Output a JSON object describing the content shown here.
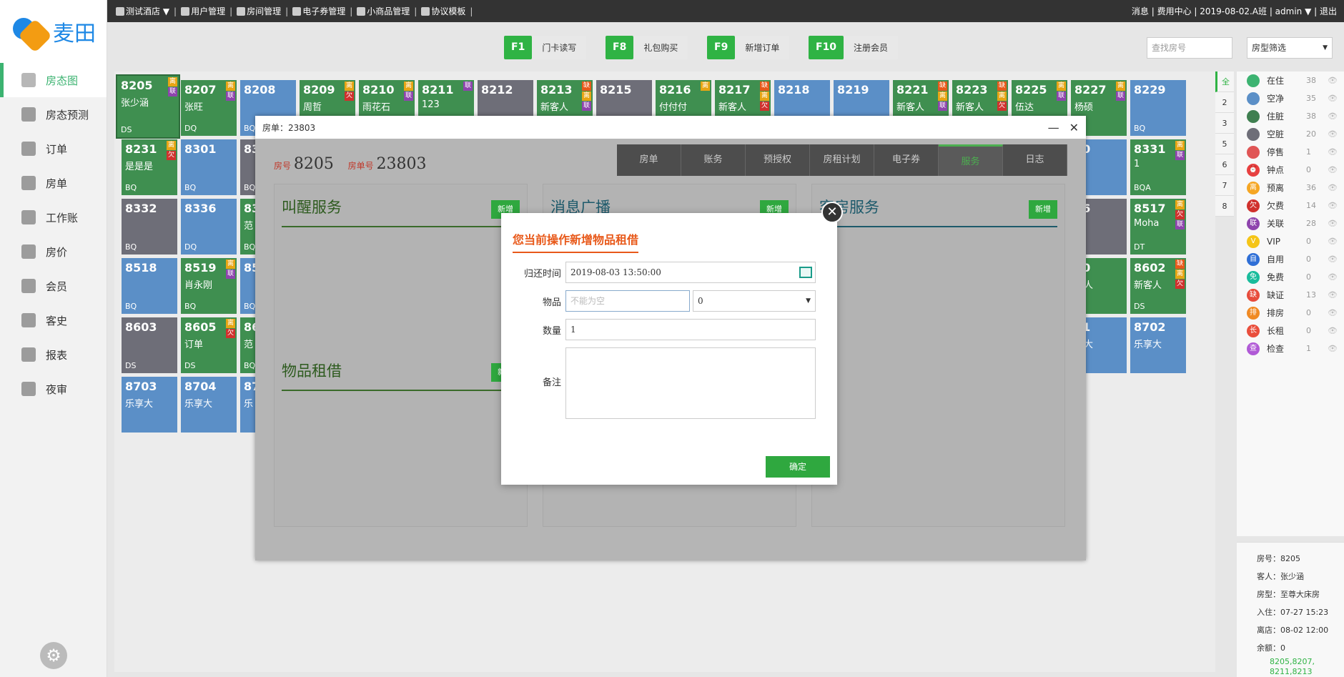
{
  "logo": {
    "text": "麦田"
  },
  "topbar": {
    "nav": [
      {
        "label": "测试酒店 ▼",
        "icon": "home-icon"
      },
      {
        "label": "用户管理",
        "icon": "user-icon"
      },
      {
        "label": "房间管理",
        "icon": "rooms-icon"
      },
      {
        "label": "电子券管理",
        "icon": "coupon-icon"
      },
      {
        "label": "小商品管理",
        "icon": "cart-icon"
      },
      {
        "label": "协议模板",
        "icon": "template-icon"
      }
    ],
    "right": "消息 | 费用中心 | 2019-08-02.A班 | admin ▼ | 退出"
  },
  "sidebar": {
    "items": [
      {
        "label": "房态图",
        "icon": "building-icon"
      },
      {
        "label": "房态预测",
        "icon": "chart-icon"
      },
      {
        "label": "订单",
        "icon": "order-icon"
      },
      {
        "label": "房单",
        "icon": "document-icon"
      },
      {
        "label": "工作账",
        "icon": "ledger-icon"
      },
      {
        "label": "房价",
        "icon": "price-icon"
      },
      {
        "label": "会员",
        "icon": "card-icon"
      },
      {
        "label": "客史",
        "icon": "person-icon"
      },
      {
        "label": "报表",
        "icon": "report-icon"
      },
      {
        "label": "夜审",
        "icon": "moon-icon"
      }
    ]
  },
  "toolbar": {
    "buttons": [
      {
        "key": "F1",
        "label": "门卡读写"
      },
      {
        "key": "F8",
        "label": "礼包购买"
      },
      {
        "key": "F9",
        "label": "新增订单"
      },
      {
        "key": "F10",
        "label": "注册会员"
      }
    ],
    "search_placeholder": "查找房号",
    "room_type_filter": "房型筛选"
  },
  "colors": {
    "green": "#3f8f50",
    "blue": "#5b8fc7",
    "gray": "#6e6e78",
    "brand": "#2fb344"
  },
  "rooms": [
    {
      "num": "8205",
      "guest": "张少涵",
      "type": "DS",
      "color": "green",
      "tags": [
        "离",
        "联"
      ]
    },
    {
      "num": "8207",
      "guest": "张旺",
      "type": "DQ",
      "color": "green",
      "tags": [
        "离",
        "联"
      ]
    },
    {
      "num": "8208",
      "guest": "",
      "type": "BQ",
      "color": "blue",
      "tags": []
    },
    {
      "num": "8209",
      "guest": "周哲",
      "type": "",
      "color": "green",
      "tags": [
        "离",
        "欠"
      ]
    },
    {
      "num": "8210",
      "guest": "雨花石",
      "type": "",
      "color": "green",
      "tags": [
        "离",
        "联"
      ]
    },
    {
      "num": "8211",
      "guest": "123",
      "type": "",
      "color": "green",
      "tags": [
        "联"
      ]
    },
    {
      "num": "8212",
      "guest": "",
      "type": "",
      "color": "gray",
      "tags": []
    },
    {
      "num": "8213",
      "guest": "新客人",
      "type": "",
      "color": "green",
      "tags": [
        "缺",
        "离",
        "联"
      ]
    },
    {
      "num": "8215",
      "guest": "",
      "type": "",
      "color": "gray",
      "tags": []
    },
    {
      "num": "8216",
      "guest": "付付付",
      "type": "",
      "color": "green",
      "tags": [
        "离"
      ]
    },
    {
      "num": "8217",
      "guest": "新客人",
      "type": "",
      "color": "green",
      "tags": [
        "缺",
        "离",
        "欠"
      ]
    },
    {
      "num": "8218",
      "guest": "",
      "type": "",
      "color": "blue",
      "tags": []
    },
    {
      "num": "8219",
      "guest": "",
      "type": "",
      "color": "blue",
      "tags": []
    },
    {
      "num": "8221",
      "guest": "新客人",
      "type": "",
      "color": "green",
      "tags": [
        "缺",
        "离",
        "联"
      ]
    },
    {
      "num": "8223",
      "guest": "新客人",
      "type": "",
      "color": "green",
      "tags": [
        "缺",
        "离",
        "欠"
      ]
    },
    {
      "num": "8225",
      "guest": "伍达",
      "type": "",
      "color": "green",
      "tags": [
        "离",
        "联"
      ]
    },
    {
      "num": "8227",
      "guest": "杨硕",
      "type": "",
      "color": "green",
      "tags": [
        "离",
        "联"
      ]
    },
    {
      "num": "8229",
      "guest": "",
      "type": "BQ",
      "color": "blue",
      "tags": []
    },
    {
      "num": "8231",
      "guest": "是是是",
      "type": "BQ",
      "color": "green",
      "tags": [
        "离",
        "欠"
      ]
    },
    {
      "num": "8301",
      "guest": "",
      "type": "BQ",
      "color": "blue",
      "tags": []
    },
    {
      "num": "8331",
      "guest": "1",
      "type": "BQA",
      "color": "green",
      "tags": [
        "离",
        "联"
      ]
    },
    {
      "num": "8332",
      "guest": "",
      "type": "BQ",
      "color": "gray",
      "tags": []
    },
    {
      "num": "8336",
      "guest": "",
      "type": "DQ",
      "color": "blue",
      "tags": []
    },
    {
      "num": "8517",
      "guest": "Moha",
      "type": "DT",
      "color": "green",
      "tags": [
        "离",
        "欠",
        "联"
      ]
    },
    {
      "num": "8518",
      "guest": "",
      "type": "BQ",
      "color": "blue",
      "tags": []
    },
    {
      "num": "8519",
      "guest": "肖永刚",
      "type": "BQ",
      "color": "green",
      "tags": [
        "离",
        "联"
      ]
    },
    {
      "num": "8602",
      "guest": "新客人",
      "type": "DS",
      "color": "green",
      "tags": [
        "缺",
        "离",
        "欠"
      ]
    },
    {
      "num": "8603",
      "guest": "",
      "type": "DS",
      "color": "gray",
      "tags": []
    },
    {
      "num": "8605",
      "guest": "订单",
      "type": "DS",
      "color": "green",
      "tags": [
        "离",
        "欠"
      ]
    },
    {
      "num": "8702",
      "guest": "乐享大",
      "type": "",
      "color": "blue",
      "tags": []
    },
    {
      "num": "8703",
      "guest": "乐享大",
      "type": "",
      "color": "blue",
      "tags": []
    },
    {
      "num": "8704",
      "guest": "乐享大",
      "type": "",
      "color": "blue",
      "tags": []
    }
  ],
  "partial_rooms": [
    {
      "num": "83",
      "guest": "",
      "type": "BQA",
      "color": "gray"
    },
    {
      "num": "83",
      "guest": "范",
      "type": "BQ",
      "color": "green"
    },
    {
      "num": "85",
      "guest": "",
      "type": "BQ",
      "color": "blue"
    },
    {
      "num": "86",
      "guest": "范",
      "type": "BQ",
      "color": "green"
    },
    {
      "num": "87",
      "guest": "乐",
      "type": "",
      "color": "blue"
    },
    {
      "num": "30",
      "guest": "",
      "type": "",
      "color": "blue"
    },
    {
      "num": "16",
      "guest": "",
      "type": "",
      "color": "gray"
    },
    {
      "num": "40",
      "guest": "客人",
      "type": "A",
      "color": "green"
    },
    {
      "num": "01",
      "guest": "享大",
      "type": "",
      "color": "blue"
    }
  ],
  "floors": [
    "全",
    "2",
    "3",
    "5",
    "6",
    "7",
    "8"
  ],
  "legend": [
    {
      "label": "在住",
      "count": "38",
      "color": "#3cb371",
      "icon": ""
    },
    {
      "label": "空净",
      "count": "35",
      "color": "#5b8fc7",
      "icon": ""
    },
    {
      "label": "住脏",
      "count": "38",
      "color": "#3f7f50",
      "icon": ""
    },
    {
      "label": "空脏",
      "count": "20",
      "color": "#6e6e78",
      "icon": ""
    },
    {
      "label": "停售",
      "count": "1",
      "color": "#e05555",
      "icon": ""
    },
    {
      "label": "钟点",
      "count": "0",
      "color": "#e84040",
      "icon": "⏰"
    },
    {
      "label": "预离",
      "count": "36",
      "color": "#f5a623",
      "icon": "离"
    },
    {
      "label": "欠费",
      "count": "14",
      "color": "#d0312d",
      "icon": "欠"
    },
    {
      "label": "关联",
      "count": "28",
      "color": "#8e44ad",
      "icon": "联"
    },
    {
      "label": "VIP",
      "count": "0",
      "color": "#f5c518",
      "icon": "V"
    },
    {
      "label": "自用",
      "count": "0",
      "color": "#2f6fd6",
      "icon": "自"
    },
    {
      "label": "免费",
      "count": "0",
      "color": "#1abc9c",
      "icon": "免"
    },
    {
      "label": "缺证",
      "count": "13",
      "color": "#e74c3c",
      "icon": "缺"
    },
    {
      "label": "排房",
      "count": "0",
      "color": "#f08a24",
      "icon": "排"
    },
    {
      "label": "长租",
      "count": "0",
      "color": "#e94e3c",
      "icon": "长"
    },
    {
      "label": "检查",
      "count": "1",
      "color": "#b05ad6",
      "icon": "查"
    }
  ],
  "roominfo": {
    "room": "房号：8205",
    "guest": "客人：张少涵",
    "type": "房型：至尊大床房",
    "checkin": "入住：07-27 15:23",
    "checkout": "离店：08-02 12:00",
    "balance": "余额：0",
    "linked": "8205,8207,",
    "linked2": "8211,8213"
  },
  "overlay": {
    "title": "房单：23803",
    "room_label": "房号",
    "room": "8205",
    "order_label": "房单号",
    "order": "23803",
    "tabs": [
      "房单",
      "账务",
      "预授权",
      "房租计划",
      "电子券",
      "服务",
      "日志"
    ],
    "active_tab": "服务",
    "panels": {
      "wake": "叫醒服务",
      "broadcast": "消息广播",
      "guestservice": "客房服务",
      "rental": "物品租借",
      "add": "新增"
    }
  },
  "modal": {
    "title": "您当前操作新增物品租借",
    "return_label": "归还时间",
    "return_value": "2019-08-03 13:50:00",
    "item_label": "物品",
    "item_placeholder": "不能为空",
    "item_select": "0",
    "qty_label": "数量",
    "qty_value": "1",
    "note_label": "备注",
    "confirm": "确定"
  }
}
